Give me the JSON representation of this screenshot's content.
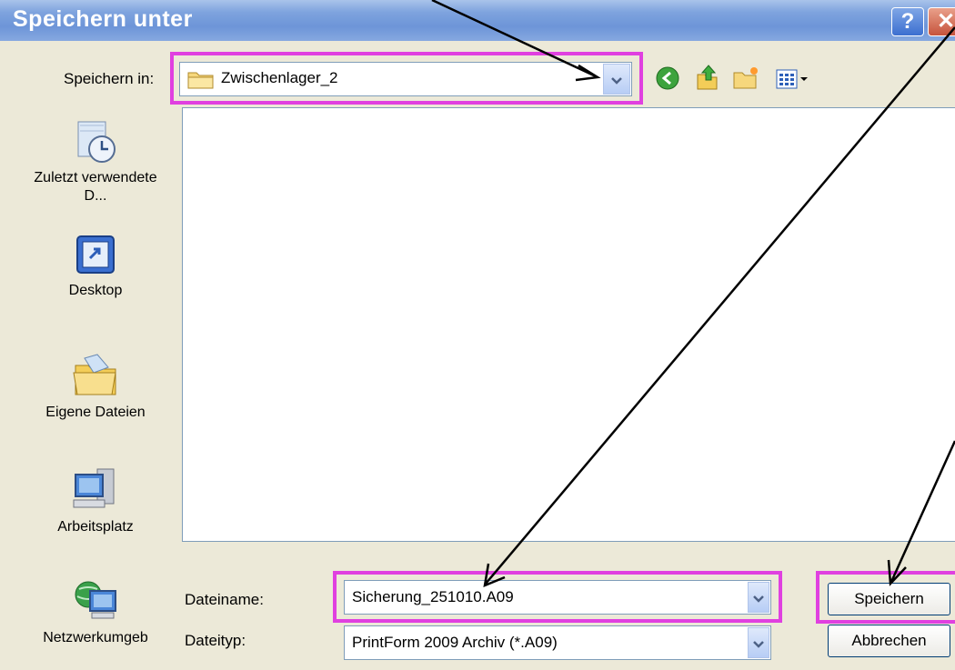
{
  "window": {
    "title": "Speichern unter",
    "help_glyph": "?",
    "close_glyph": "✕"
  },
  "toolbar": {
    "save_in_label": "Speichern in:",
    "location_value": "Zwischenlager_2",
    "icons": [
      "back-icon",
      "up-folder-icon",
      "new-folder-icon",
      "view-menu-icon"
    ]
  },
  "places": [
    {
      "label": "Zuletzt verwendete D...",
      "icon": "recent-documents-icon"
    },
    {
      "label": "Desktop",
      "icon": "desktop-icon"
    },
    {
      "label": "Eigene Dateien",
      "icon": "my-documents-icon"
    },
    {
      "label": "Arbeitsplatz",
      "icon": "my-computer-icon"
    },
    {
      "label": "Netzwerkumgeb",
      "icon": "network-icon"
    }
  ],
  "form": {
    "filename_label": "Dateiname:",
    "filename_value": "Sicherung_251010.A09",
    "filetype_label": "Dateityp:",
    "filetype_value": "PrintForm 2009 Archiv (*.A09)"
  },
  "buttons": {
    "save": "Speichern",
    "cancel": "Abbrechen"
  },
  "colors": {
    "highlight": "#e040e0",
    "titlebar": "#6d95d8"
  }
}
